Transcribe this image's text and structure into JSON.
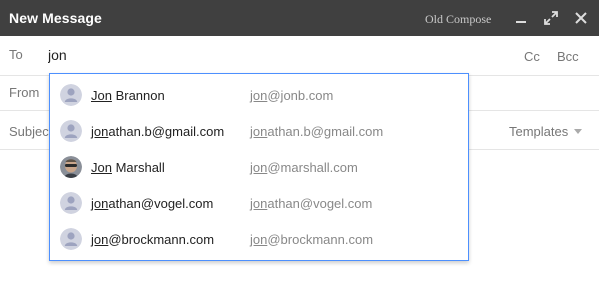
{
  "window": {
    "title": "New Message",
    "old_compose": "Old Compose",
    "controls": [
      "minimize-icon",
      "expand-icon",
      "close-icon"
    ]
  },
  "to": {
    "label": "To",
    "value": "jon",
    "cc": "Cc",
    "bcc": "Bcc"
  },
  "from": {
    "label": "From"
  },
  "subject": {
    "label": "Subject",
    "templates": "Templates"
  },
  "suggestions": [
    {
      "name_match": "Jon",
      "name_rest": " Brannon",
      "email_match": "jon",
      "email_rest": "@jonb.com",
      "avatar": "default-person-icon"
    },
    {
      "name_match": "jon",
      "name_rest": "athan.b@gmail.com",
      "email_match": "jon",
      "email_rest": "athan.b@gmail.com",
      "avatar": "default-person-icon"
    },
    {
      "name_match": "Jon",
      "name_rest": " Marshall",
      "email_match": "jon",
      "email_rest": "@marshall.com",
      "avatar": "photo"
    },
    {
      "name_match": "jon",
      "name_rest": "athan@vogel.com",
      "email_match": "jon",
      "email_rest": "athan@vogel.com",
      "avatar": "default-person-icon"
    },
    {
      "name_match": "jon",
      "name_rest": "@brockmann.com",
      "email_match": "jon",
      "email_rest": "@brockmann.com",
      "avatar": "default-person-icon"
    }
  ],
  "colors": {
    "titlebar": "#404040",
    "dropdown_border": "#4d90fe",
    "label_gray": "#777777"
  }
}
